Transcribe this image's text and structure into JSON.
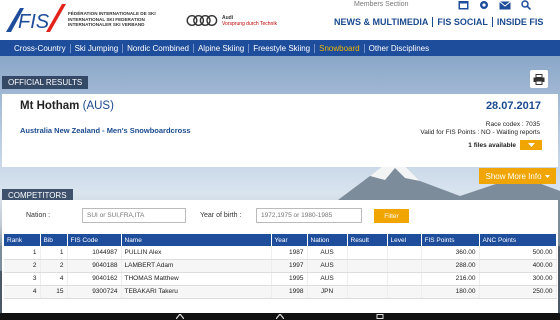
{
  "header": {
    "logo_text": "FIS",
    "federation_lines": [
      "FÉDÉRATION INTERNATIONALE DE SKI",
      "INTERNATIONAL SKI FEDERATION",
      "INTERNATIONALER SKI VERBAND"
    ],
    "sponsor_brand": "Audi",
    "sponsor_slogan": "Vorsprung durch Technik",
    "members_label": "Members Section",
    "top_nav": [
      "NEWS & MULTIMEDIA",
      "FIS SOCIAL",
      "INSIDE FIS"
    ],
    "icons": [
      "calendar-icon",
      "gear-icon",
      "mail-icon",
      "search-icon"
    ]
  },
  "nav": {
    "items": [
      "Cross-Country",
      "Ski Jumping",
      "Nordic Combined",
      "Alpine Skiing",
      "Freestyle Skiing",
      "Snowboard",
      "Other Disciplines"
    ],
    "active": "Snowboard",
    "active_color": "#f0b400"
  },
  "results": {
    "section_label": "OFFICIAL RESULTS",
    "venue": "Mt Hotham",
    "nation": "(AUS)",
    "date": "28.07.2017",
    "event": "Australia New Zealand - Men's Snowboardcross",
    "race_codex": "Race codex : 7035",
    "fis_points_valid": "Valid for FIS Points : NO - Waiting reports",
    "files_label": "1 files available",
    "show_more_label": "Show More Info"
  },
  "competitors": {
    "section_label": "COMPETITORS",
    "nation_label": "Nation :",
    "nation_placeholder": "SUI or SUI,FRA,ITA",
    "year_label": "Year of birth :",
    "year_placeholder": "1972,1975 or 1980-1985",
    "filter_label": "Filter",
    "columns": [
      "Rank",
      "Bib",
      "FIS Code",
      "Name",
      "Year",
      "Nation",
      "Result",
      "Level",
      "FIS Points",
      "ANC Points"
    ],
    "rows": [
      {
        "rank": "1",
        "bib": "1",
        "code": "1044987",
        "name": "PULLIN Alex",
        "year": "1987",
        "nation": "AUS",
        "result": "",
        "level": "",
        "fis": "360.00",
        "anc": "500.00"
      },
      {
        "rank": "2",
        "bib": "2",
        "code": "9040188",
        "name": "LAMBERT Adam",
        "year": "1997",
        "nation": "AUS",
        "result": "",
        "level": "",
        "fis": "288.00",
        "anc": "400.00"
      },
      {
        "rank": "3",
        "bib": "4",
        "code": "9040162",
        "name": "THOMAS Matthew",
        "year": "1995",
        "nation": "AUS",
        "result": "",
        "level": "",
        "fis": "216.00",
        "anc": "300.00"
      },
      {
        "rank": "4",
        "bib": "15",
        "code": "9300724",
        "name": "TEBAKARI Takeru",
        "year": "1998",
        "nation": "JPN",
        "result": "",
        "level": "",
        "fis": "180.00",
        "anc": "250.00"
      }
    ]
  },
  "colors": {
    "brand_blue": "#1e4d9b",
    "accent_orange": "#f0a500"
  }
}
